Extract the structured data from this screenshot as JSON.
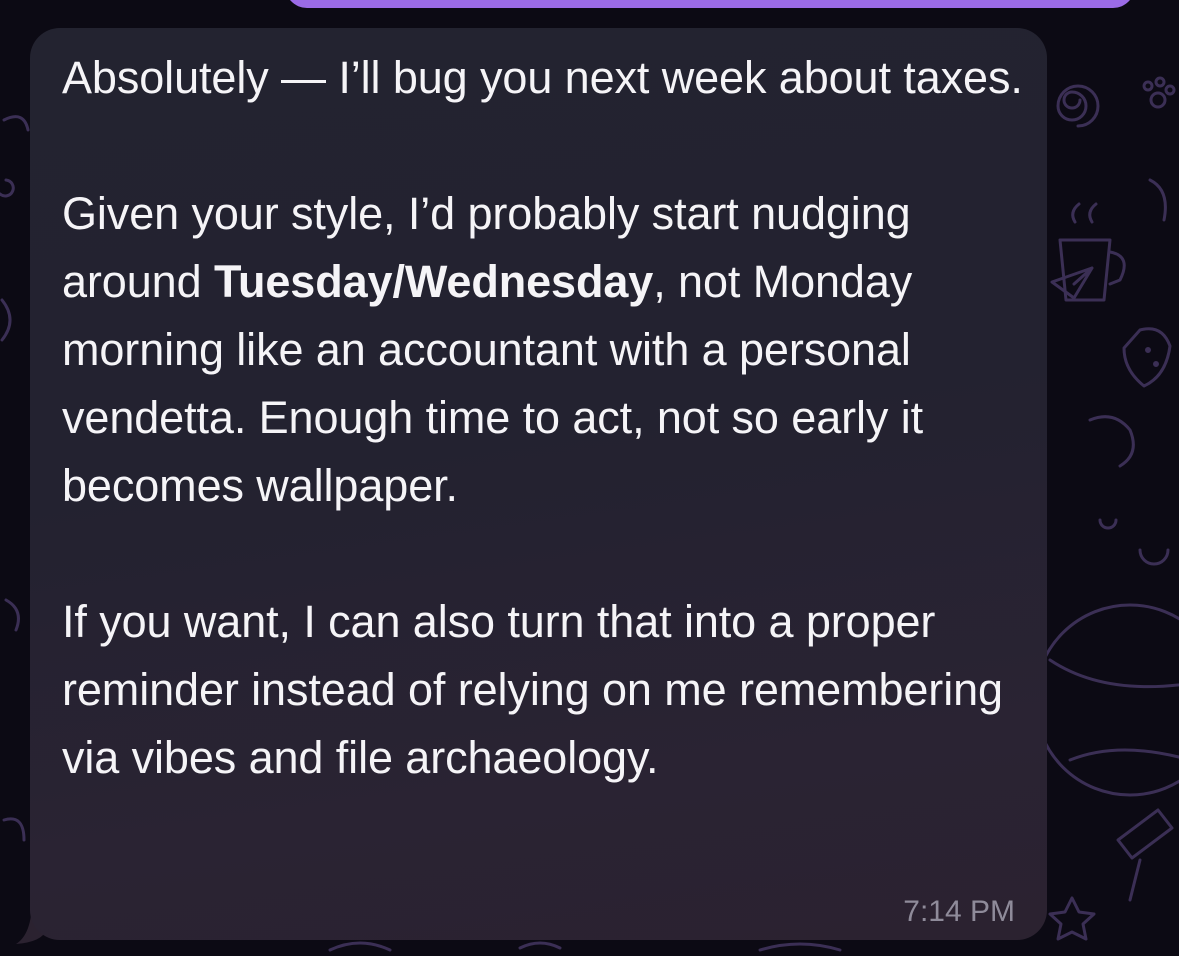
{
  "colors": {
    "background": "#0c0a14",
    "wallpaper_doodle": "#3b2f55",
    "incoming_bubble": "#232330",
    "outgoing_bubble": "#9b6be6",
    "message_text": "#f5f4f7",
    "timestamp_text": "#8f8b9a"
  },
  "message": {
    "paragraph_1": "Absolutely — I’ll bug you next week about taxes.",
    "paragraph_2_before": "Given your style, I’d probably start nudging around ",
    "paragraph_2_bold": "Tuesday/Wednesday",
    "paragraph_2_after": ", not Monday morning like an accountant with a personal vendetta. Enough time to act, not so early it becomes wallpaper.",
    "paragraph_3": "If you want, I can also turn that into a proper reminder instead of relying on me remembering via vibes and file archaeology.",
    "timestamp": "7:14 PM"
  },
  "wallpaper_icons": [
    "spiral-doodle-icon",
    "paw-doodle-icon",
    "mug-doodle-icon",
    "paper-plane-doodle-icon",
    "strawberry-doodle-icon",
    "planet-doodle-icon",
    "star-doodle-icon",
    "telescope-doodle-icon"
  ]
}
